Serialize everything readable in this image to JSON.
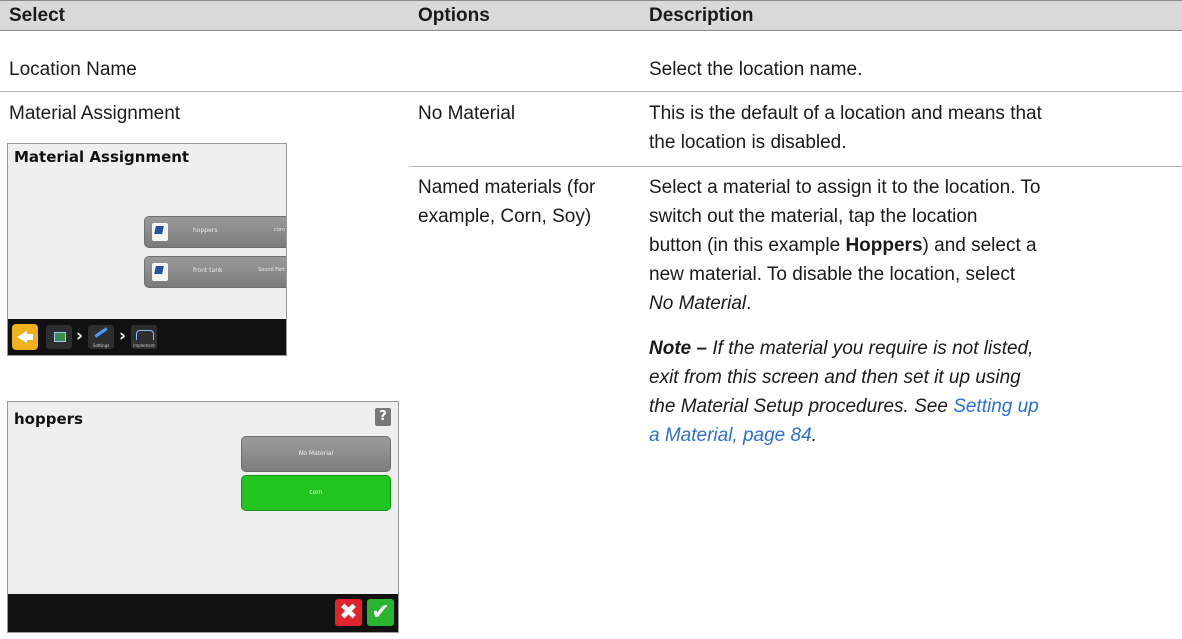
{
  "table": {
    "headers": {
      "select": "Select",
      "options": "Options",
      "description": "Description"
    },
    "row1": {
      "select": "Location Name",
      "description": "Select the location name."
    },
    "row2": {
      "select": "Material Assignment",
      "option_a": "No Material",
      "desc_a_line1": "This is the default of a location and means that",
      "desc_a_line2": "the location is disabled.",
      "option_b_line1": "Named materials (for",
      "option_b_line2": "example, Corn, Soy)",
      "desc_b_line1": "Select a material to assign it to the location. To",
      "desc_b_line2": "switch out the material, tap the location",
      "desc_b_line3_pre": "button (in this example ",
      "desc_b_line3_bold": "Hoppers",
      "desc_b_line3_post": ") and select a",
      "desc_b_line4": "new material. To disable the location, select",
      "desc_b_line5_italic": "No Material",
      "desc_b_line5_post": ".",
      "note_bold": "Note –",
      "note_line1": " If the material you require is not listed,",
      "note_line2": "exit from this screen and then set it up using",
      "note_line3_pre": "the Material Setup procedures. See ",
      "note_link_part1": "Setting up",
      "note_link_part2": "a Material, page 84",
      "note_end": "."
    }
  },
  "screen1": {
    "title": "Material Assignment",
    "buttons": [
      {
        "name": "hoppers",
        "material": "corn"
      },
      {
        "name": "front tank",
        "material": "Sound Fert"
      }
    ],
    "breadcrumbs": [
      "",
      "Settings",
      "Implement"
    ]
  },
  "screen2": {
    "title": "hoppers",
    "help": "?",
    "options": [
      "No Material",
      "corn"
    ],
    "cancel": "✖",
    "confirm": "✔"
  },
  "colors": {
    "header_bg": "#d9d9d9",
    "link": "#2b6fd6",
    "selected_option": "#22c41f",
    "back_button": "#f0b21c"
  }
}
